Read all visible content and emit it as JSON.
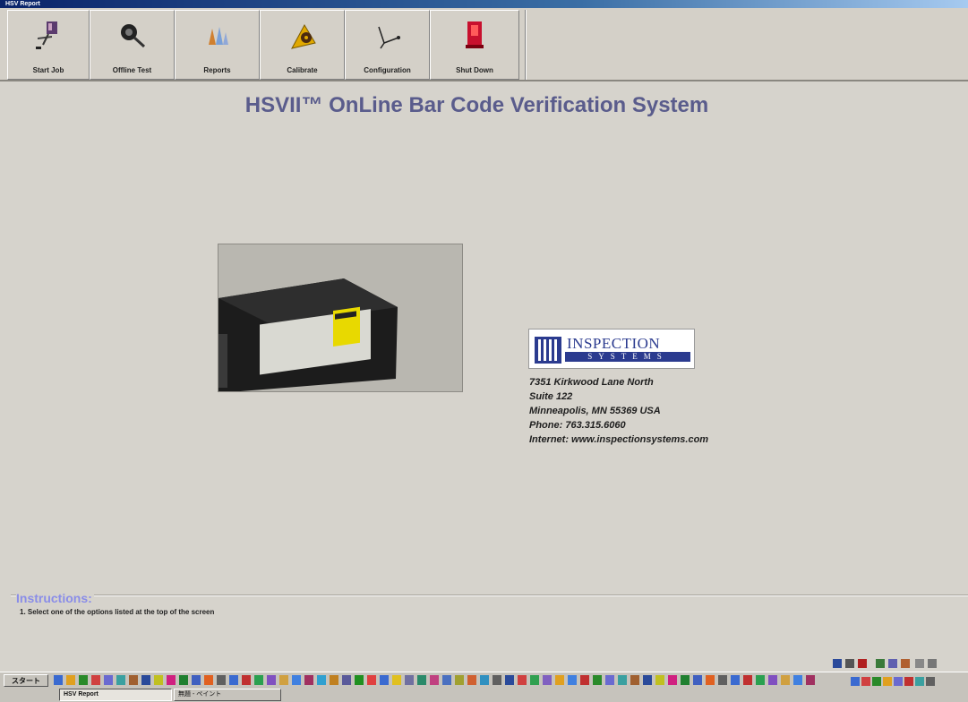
{
  "window": {
    "title": "HSV Report"
  },
  "toolbar": {
    "buttons": [
      {
        "label": "Start Job",
        "icon": "start-job-icon"
      },
      {
        "label": "Offline Test",
        "icon": "offline-test-icon"
      },
      {
        "label": "Reports",
        "icon": "reports-icon"
      },
      {
        "label": "Calibrate",
        "icon": "calibrate-icon"
      },
      {
        "label": "Configuration",
        "icon": "configuration-icon"
      },
      {
        "label": "Shut Down",
        "icon": "shut-down-icon"
      }
    ]
  },
  "main": {
    "title": "HSVII™ OnLine Bar Code Verification System",
    "logo": {
      "brand": "INSPECTION",
      "sub": "SYSTEMS"
    },
    "address": {
      "line1": "7351 Kirkwood Lane North",
      "line2": "Suite 122",
      "line3": "Minneapolis, MN 55369 USA",
      "line4": "Phone: 763.315.6060",
      "line5": "Internet: www.inspectionsystems.com"
    }
  },
  "instructions": {
    "title": "Instructions:",
    "step1": "1. Select one of the options listed at the top of the screen"
  },
  "taskbar": {
    "start_label": "スタート",
    "tasks": [
      {
        "label": "HSV Report",
        "active": true
      },
      {
        "label": "無題 - ペイント",
        "active": false
      }
    ]
  }
}
